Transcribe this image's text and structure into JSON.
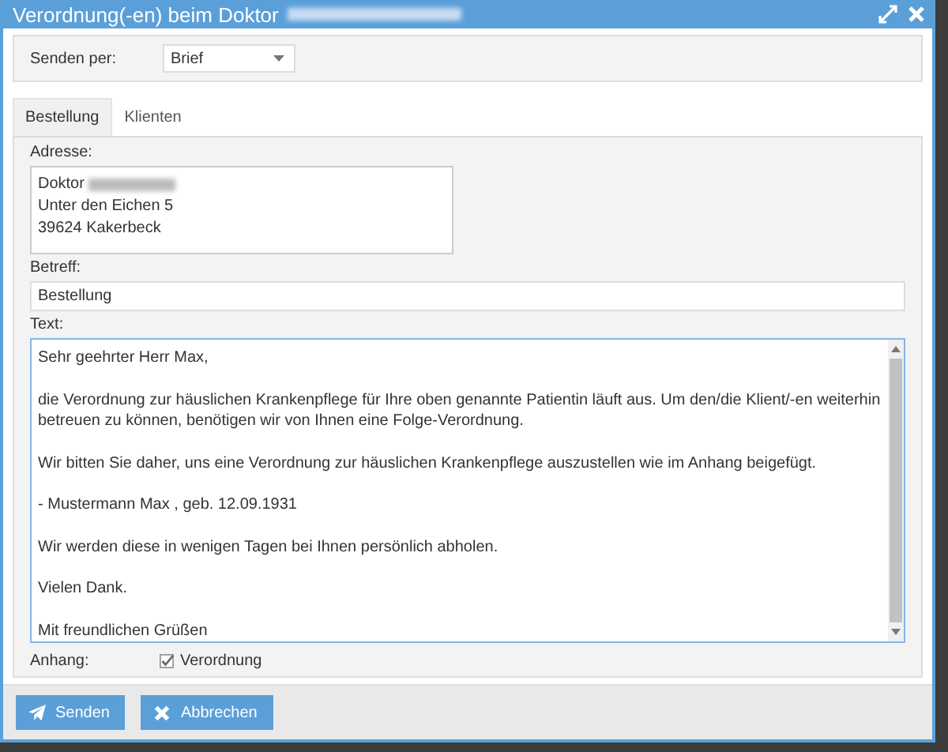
{
  "window": {
    "title": "Verordnung(-en) beim Doktor"
  },
  "send_via": {
    "label": "Senden per:",
    "value": "Brief"
  },
  "tabs": [
    {
      "label": "Bestellung",
      "selected": true
    },
    {
      "label": "Klienten",
      "selected": false
    }
  ],
  "address": {
    "label": "Adresse:",
    "lines": [
      "Doktor",
      "Unter den Eichen 5",
      "39624 Kakerbeck"
    ]
  },
  "subject": {
    "label": "Betreff:",
    "value": "Bestellung"
  },
  "text": {
    "label": "Text:",
    "paragraphs": [
      "Sehr geehrter Herr Max,",
      "die Verordnung zur häuslichen Krankenpflege für Ihre oben genannte Patientin läuft aus. Um den/die Klient/-en weiterhin betreuen zu können, benötigen wir von Ihnen eine Folge-Verordnung.",
      "Wir bitten Sie daher, uns eine Verordnung zur häuslichen Krankenpflege auszustellen wie im Anhang beigefügt.",
      "- Mustermann Max , geb. 12.09.1931",
      "Wir werden diese in wenigen Tagen bei Ihnen persönlich abholen.",
      "Vielen Dank.",
      "Mit freundlichen Grüßen"
    ]
  },
  "attachment": {
    "label": "Anhang:",
    "items": [
      {
        "label": "Verordnung",
        "checked": true
      }
    ]
  },
  "buttons": [
    {
      "label": "Senden",
      "kind": "send"
    },
    {
      "label": "Abbrechen",
      "kind": "cancel"
    }
  ]
}
